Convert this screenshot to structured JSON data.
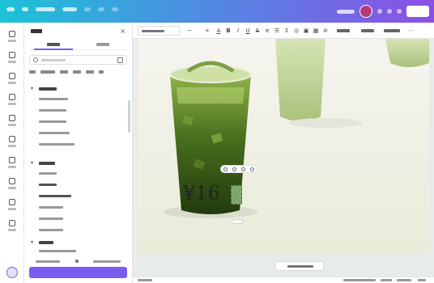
{
  "topbar": {
    "menu_items": [
      "",
      "",
      "",
      ""
    ],
    "doc_title": "",
    "share_label": ""
  },
  "rail": {
    "items": [
      {
        "icon": "layout-icon",
        "label": ""
      },
      {
        "icon": "elements-icon",
        "label": ""
      },
      {
        "icon": "text-icon",
        "label": ""
      },
      {
        "icon": "brand-icon",
        "label": ""
      },
      {
        "icon": "uploads-icon",
        "label": ""
      },
      {
        "icon": "draw-icon",
        "label": ""
      },
      {
        "icon": "projects-icon",
        "label": ""
      },
      {
        "icon": "apps-icon",
        "label": ""
      },
      {
        "icon": "photos-icon",
        "label": ""
      },
      {
        "icon": "more-icon",
        "label": ""
      }
    ]
  },
  "panel": {
    "title": "",
    "tabs": [
      {
        "label": ""
      },
      {
        "label": ""
      }
    ],
    "search_placeholder": "",
    "filter_chips": [
      "",
      "",
      "",
      "",
      "",
      ""
    ],
    "sections": [
      {
        "title": "",
        "items": [
          "",
          "",
          "",
          "",
          ""
        ]
      },
      {
        "title": "",
        "items": [
          "",
          "",
          "",
          "",
          "",
          ""
        ]
      },
      {
        "title": "",
        "items": [
          ""
        ]
      }
    ],
    "page_labels": [
      "",
      ""
    ],
    "footer_button": ""
  },
  "toolbar": {
    "font_name": "",
    "font_size": "",
    "actions": [
      "",
      "",
      ""
    ]
  },
  "canvas": {
    "price_text": "¥16",
    "price_tag_text": "",
    "add_page_label": ""
  },
  "footer": {
    "notes_label": "",
    "zoom": "",
    "page_counter": ""
  },
  "colors": {
    "accent": "#7b5cf0",
    "drink_dark": "#3c5d18",
    "drink_light": "#b7cf8e",
    "topbar_start": "#1cc3d6",
    "topbar_end": "#8c4fe6"
  }
}
